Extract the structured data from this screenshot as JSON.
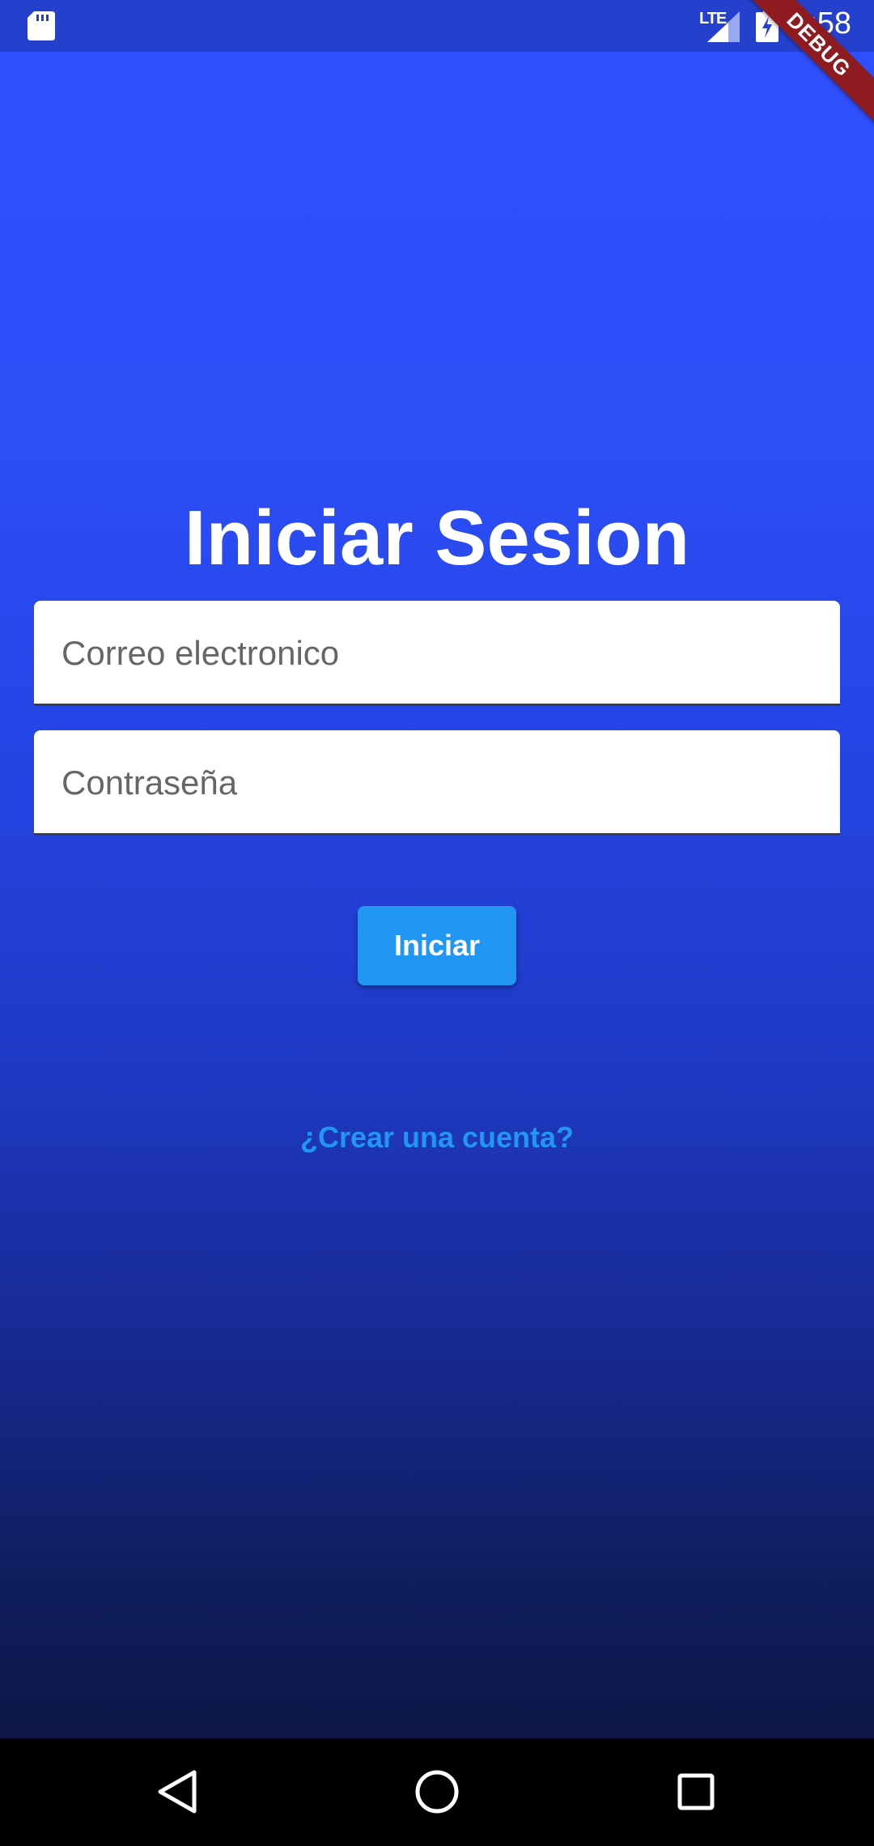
{
  "status_bar": {
    "network_label": "LTE",
    "time": "9:58",
    "icons": [
      "sd-card-icon",
      "signal-icon",
      "battery-charging-icon"
    ]
  },
  "debug_banner": "DEBUG",
  "login": {
    "title": "Iniciar Sesion",
    "email_placeholder": "Correo electronico",
    "email_value": "",
    "password_placeholder": "Contraseña",
    "password_value": "",
    "submit_label": "Iniciar",
    "create_account_label": "¿Crear una cuenta?"
  },
  "nav_bar": {
    "icons": [
      "back-icon",
      "home-icon",
      "recents-icon"
    ]
  },
  "colors": {
    "background_top": "#2d50fe",
    "background_bottom": "#0b1338",
    "button": "#2196f3",
    "link": "#2196f3",
    "debug_ribbon": "#8e1b1f"
  }
}
